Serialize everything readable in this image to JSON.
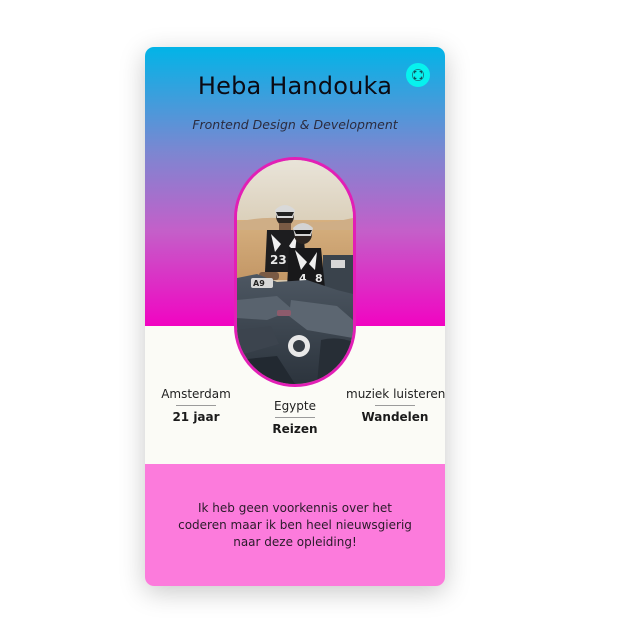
{
  "profile": {
    "name": "Heba Handouka",
    "subtitle": "Frontend Design & Development",
    "photo_alt": "Twee personen op een quad in de woestijn"
  },
  "details": {
    "left": {
      "top": "Amsterdam",
      "bottom": "21 jaar"
    },
    "middle": {
      "top": "Egypte",
      "bottom": "Reizen"
    },
    "right": {
      "top": "muziek luisteren",
      "bottom": "Wandelen"
    }
  },
  "about": {
    "text": "Ik heb geen voorkennis over het coderen maar ik ben heel nieuwsgierig naar deze opleiding!"
  },
  "icons": {
    "fullscreen": "fullscreen-icon"
  },
  "colors": {
    "gradient_top": "#02b4e7",
    "gradient_bottom": "#f104c2",
    "photo_border": "#e21fb6",
    "info_bg": "#fbfbf6",
    "about_bg": "#fc7bdc",
    "button_bg": "#07f2ee"
  }
}
